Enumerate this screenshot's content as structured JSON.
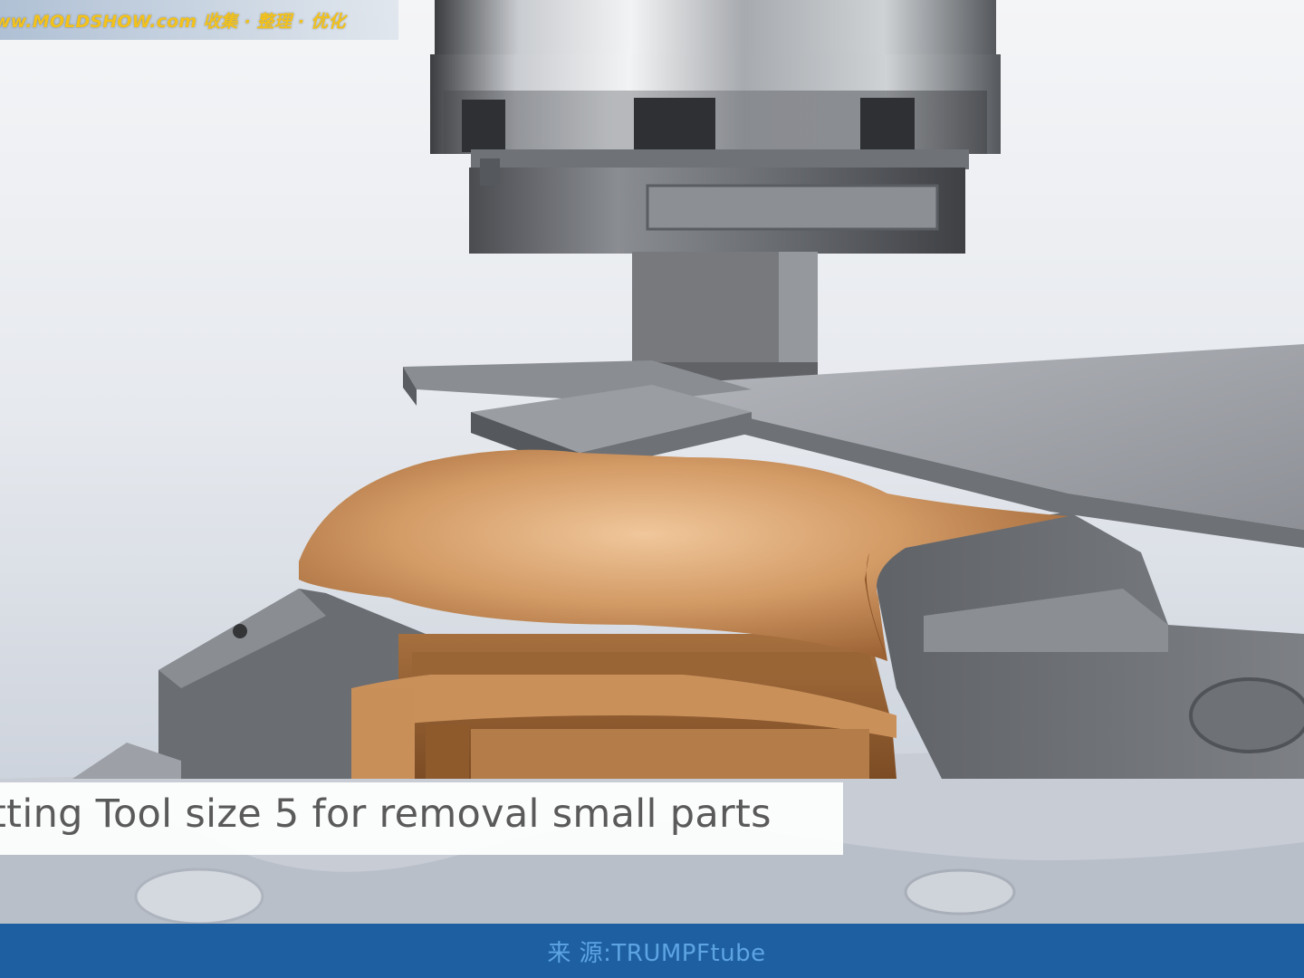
{
  "video_frame": {
    "watermark": "ww.MOLDSHOW.com   收集 · 整理 · 优化",
    "caption": "tting Tool size 5 for removal small parts",
    "source_label": "来 源:TRUMPFtube",
    "colors": {
      "watermark_text": "#f3c21a",
      "caption_text": "#5a5a5a",
      "source_bar": "#1d5fa0",
      "source_text": "#5ea4e3",
      "copper_part": "#d19a66",
      "steel_part": "#7e8186"
    }
  }
}
